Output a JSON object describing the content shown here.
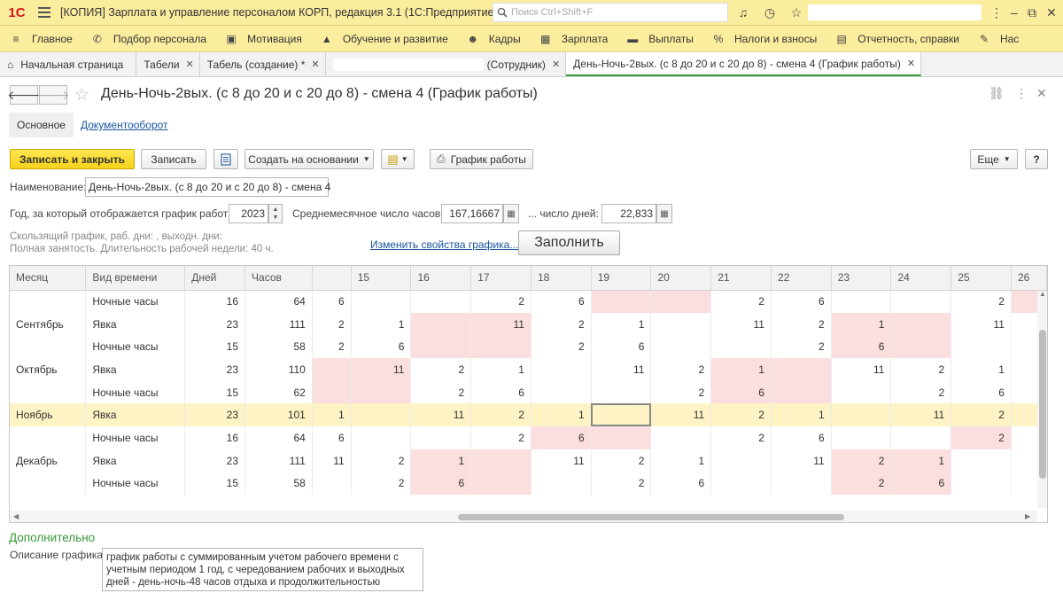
{
  "app": {
    "logo": "1С",
    "title": "[КОПИЯ] Зарплата и управление персоналом КОРП, редакция 3.1  (1С:Предприятие)",
    "search_placeholder": "Поиск Ctrl+Shift+F"
  },
  "menu": [
    {
      "icon": "home-icon",
      "glyph": "≡",
      "label": "Главное"
    },
    {
      "icon": "recruitment-icon",
      "glyph": "✆",
      "label": "Подбор персонала"
    },
    {
      "icon": "gift-icon",
      "glyph": "▣",
      "label": "Мотивация"
    },
    {
      "icon": "graduation-icon",
      "glyph": "▲",
      "label": "Обучение и развитие"
    },
    {
      "icon": "people-icon",
      "glyph": "☻",
      "label": "Кадры"
    },
    {
      "icon": "calculator-icon",
      "glyph": "▦",
      "label": "Зарплата"
    },
    {
      "icon": "wallet-icon",
      "glyph": "▬",
      "label": "Выплаты"
    },
    {
      "icon": "percent-icon",
      "glyph": "%",
      "label": "Налоги и взносы"
    },
    {
      "icon": "report-icon",
      "glyph": "▤",
      "label": "Отчетность, справки"
    },
    {
      "icon": "wrench-icon",
      "glyph": "✎",
      "label": "Нас"
    }
  ],
  "tabs": [
    {
      "label": "Начальная страница",
      "home": true
    },
    {
      "label": "Табели"
    },
    {
      "label": "Табель (создание) *"
    },
    {
      "label": "(Сотрудник)",
      "blank": true
    },
    {
      "label": "День-Ночь-2вых. (с 8 до 20 и с 20 до 8) - смена 4 (График работы)",
      "active": true
    }
  ],
  "form": {
    "title": "День-Ночь-2вых. (с 8 до 20 и с 20 до 8) - смена 4 (График работы)",
    "subtab_main": "Основное",
    "subtab_docflow": "Документооборот",
    "btn_save_close": "Записать и закрыть",
    "btn_save": "Записать",
    "btn_create_based": "Создать на основании",
    "btn_schedule": "График работы",
    "btn_more": "Еще",
    "btn_help": "?",
    "name_label": "Наименование:",
    "name_value": "День-Ночь-2вых. (с 8 до 20 и с 20 до 8) - смена 4",
    "year_label": "Год, за который отображается график работы:",
    "year_value": "2023",
    "avg_hours_label": "Среднемесячное число часов:",
    "avg_hours_value": "167,16667",
    "days_label": "... число дней:",
    "days_value": "22,833",
    "hint1": "Скользящий график, раб. дни: , выходн. дни:",
    "hint2": "Полная занятость. Длительность рабочей недели: 40 ч.",
    "change_link": "Изменить свойства графика...",
    "fill_btn": "Заполнить",
    "section_extra": "Дополнительно",
    "desc_label": "Описание графика:",
    "desc_value": "график работы с суммированным учетом рабочего времени с учетным периодом 1 год, с чередованием рабочих и выходных дней - день-ночь-48 часов отдыха и продолжительностью"
  },
  "grid": {
    "headers": [
      "Месяц",
      "Вид времени",
      "Дней",
      "Часов",
      "",
      "15",
      "16",
      "17",
      "18",
      "19",
      "20",
      "21",
      "22",
      "23",
      "24",
      "25",
      "26"
    ],
    "rows": [
      {
        "month": "",
        "kind": "Ночные часы",
        "days": "16",
        "hours": "64",
        "cells": [
          "6",
          "",
          "",
          "2",
          "6",
          "",
          "",
          "2",
          "6",
          "",
          "",
          "2",
          ""
        ],
        "pink": [
          5,
          6,
          12
        ]
      },
      {
        "month": "Сентябрь",
        "kind": "Явка",
        "days": "23",
        "hours": "111",
        "cells": [
          "2",
          "1",
          "",
          "11",
          "2",
          "1",
          "",
          "11",
          "2",
          "1",
          "",
          "11",
          ""
        ],
        "pink": [
          2,
          3,
          9,
          10
        ]
      },
      {
        "month": "",
        "kind": "Ночные часы",
        "days": "15",
        "hours": "58",
        "cells": [
          "2",
          "6",
          "",
          "",
          "2",
          "6",
          "",
          "",
          "2",
          "6",
          "",
          "",
          ""
        ],
        "pink": [
          2,
          3,
          9,
          10
        ]
      },
      {
        "month": "Октябрь",
        "kind": "Явка",
        "days": "23",
        "hours": "110",
        "cells": [
          "",
          "11",
          "2",
          "1",
          "",
          "11",
          "2",
          "1",
          "",
          "11",
          "2",
          "1",
          ""
        ],
        "pink": [
          0,
          1,
          7,
          8
        ]
      },
      {
        "month": "",
        "kind": "Ночные часы",
        "days": "15",
        "hours": "62",
        "cells": [
          "",
          "",
          "2",
          "6",
          "",
          "",
          "2",
          "6",
          "",
          "",
          "2",
          "6",
          ""
        ],
        "pink": [
          0,
          1,
          7,
          8
        ]
      },
      {
        "month": "Ноябрь",
        "kind": "Явка",
        "days": "23",
        "hours": "101",
        "cells": [
          "1",
          "",
          "11",
          "2",
          "1",
          "",
          "11",
          "2",
          "1",
          "",
          "11",
          "2",
          ""
        ],
        "pink": [],
        "highlight": true,
        "cursor": 5
      },
      {
        "month": "",
        "kind": "Ночные часы",
        "days": "16",
        "hours": "64",
        "cells": [
          "6",
          "",
          "",
          "2",
          "6",
          "",
          "",
          "2",
          "6",
          "",
          "",
          "2",
          ""
        ],
        "pink": [
          4,
          5,
          11
        ]
      },
      {
        "month": "Декабрь",
        "kind": "Явка",
        "days": "23",
        "hours": "111",
        "cells": [
          "11",
          "2",
          "1",
          "",
          "11",
          "2",
          "1",
          "",
          "11",
          "2",
          "1",
          "",
          ""
        ],
        "pink": [
          2,
          3,
          9,
          10
        ]
      },
      {
        "month": "",
        "kind": "Ночные часы",
        "days": "15",
        "hours": "58",
        "cells": [
          "",
          "2",
          "6",
          "",
          "",
          "2",
          "6",
          "",
          "",
          "2",
          "6",
          "",
          ""
        ],
        "pink": [
          2,
          3,
          9,
          10
        ]
      }
    ]
  },
  "colors": {
    "accent_yellow": "#fbed9e",
    "green": "#3a9a3a",
    "pink": "#fbdede",
    "link": "#1a55a0"
  }
}
